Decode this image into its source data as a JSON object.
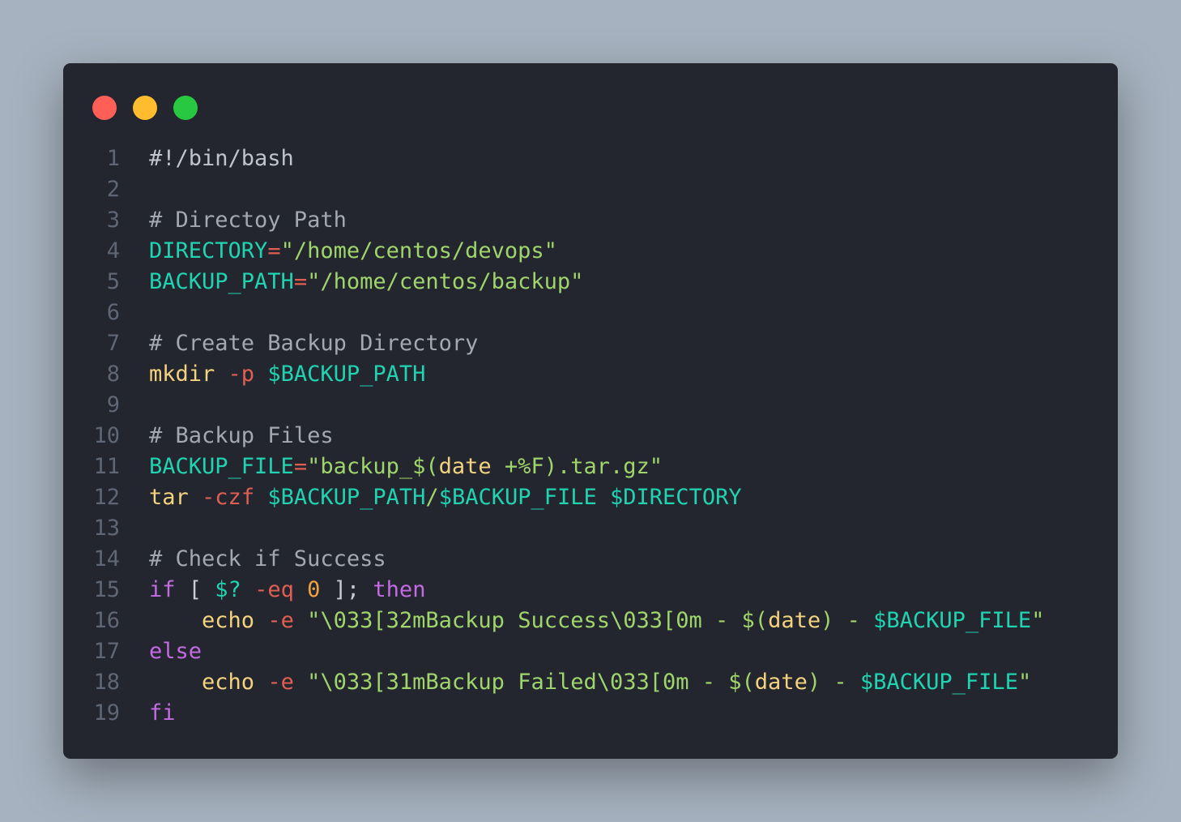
{
  "window": {
    "controls": [
      {
        "name": "close",
        "color": "#ff5f57"
      },
      {
        "name": "minimize",
        "color": "#febc2e"
      },
      {
        "name": "maximize",
        "color": "#28c840"
      }
    ]
  },
  "code": {
    "language": "bash",
    "lines": [
      {
        "n": "1",
        "tokens": [
          {
            "t": "#!/bin/bash",
            "c": "shebang"
          }
        ]
      },
      {
        "n": "2",
        "tokens": []
      },
      {
        "n": "3",
        "tokens": [
          {
            "t": "# Directoy Path",
            "c": "comment"
          }
        ]
      },
      {
        "n": "4",
        "tokens": [
          {
            "t": "DIRECTORY",
            "c": "var"
          },
          {
            "t": "=",
            "c": "op"
          },
          {
            "t": "\"/home/centos/devops\"",
            "c": "str"
          }
        ]
      },
      {
        "n": "5",
        "tokens": [
          {
            "t": "BACKUP_PATH",
            "c": "var"
          },
          {
            "t": "=",
            "c": "op"
          },
          {
            "t": "\"/home/centos/backup\"",
            "c": "str"
          }
        ]
      },
      {
        "n": "6",
        "tokens": []
      },
      {
        "n": "7",
        "tokens": [
          {
            "t": "# Create Backup Directory",
            "c": "comment"
          }
        ]
      },
      {
        "n": "8",
        "tokens": [
          {
            "t": "mkdir",
            "c": "cmd"
          },
          {
            "t": " ",
            "c": "plain"
          },
          {
            "t": "-p",
            "c": "flag"
          },
          {
            "t": " ",
            "c": "plain"
          },
          {
            "t": "$BACKUP_PATH",
            "c": "var"
          }
        ]
      },
      {
        "n": "9",
        "tokens": []
      },
      {
        "n": "10",
        "tokens": [
          {
            "t": "# Backup Files",
            "c": "comment"
          }
        ]
      },
      {
        "n": "11",
        "tokens": [
          {
            "t": "BACKUP_FILE",
            "c": "var"
          },
          {
            "t": "=",
            "c": "op"
          },
          {
            "t": "\"backup_$(",
            "c": "str"
          },
          {
            "t": "date",
            "c": "cmd"
          },
          {
            "t": " +%F).tar.gz\"",
            "c": "str"
          }
        ]
      },
      {
        "n": "12",
        "tokens": [
          {
            "t": "tar",
            "c": "cmd"
          },
          {
            "t": " ",
            "c": "plain"
          },
          {
            "t": "-czf",
            "c": "flag"
          },
          {
            "t": " ",
            "c": "plain"
          },
          {
            "t": "$BACKUP_PATH",
            "c": "var"
          },
          {
            "t": "/",
            "c": "str"
          },
          {
            "t": "$BACKUP_FILE",
            "c": "var"
          },
          {
            "t": " ",
            "c": "plain"
          },
          {
            "t": "$DIRECTORY",
            "c": "var"
          }
        ]
      },
      {
        "n": "13",
        "tokens": []
      },
      {
        "n": "14",
        "tokens": [
          {
            "t": "# Check if Success",
            "c": "comment"
          }
        ]
      },
      {
        "n": "15",
        "tokens": [
          {
            "t": "if",
            "c": "kw"
          },
          {
            "t": " [ ",
            "c": "plain"
          },
          {
            "t": "$?",
            "c": "var"
          },
          {
            "t": " ",
            "c": "plain"
          },
          {
            "t": "-eq",
            "c": "flag"
          },
          {
            "t": " ",
            "c": "plain"
          },
          {
            "t": "0",
            "c": "num"
          },
          {
            "t": " ]; ",
            "c": "plain"
          },
          {
            "t": "then",
            "c": "kw"
          }
        ]
      },
      {
        "n": "16",
        "tokens": [
          {
            "t": "    ",
            "c": "plain"
          },
          {
            "t": "echo",
            "c": "cmd"
          },
          {
            "t": " ",
            "c": "plain"
          },
          {
            "t": "-e",
            "c": "flag"
          },
          {
            "t": " ",
            "c": "plain"
          },
          {
            "t": "\"\\033[32mBackup Success\\033[0m - $(",
            "c": "str"
          },
          {
            "t": "date",
            "c": "cmd"
          },
          {
            "t": ") - ",
            "c": "str"
          },
          {
            "t": "$BACKUP_FILE",
            "c": "var"
          },
          {
            "t": "\"",
            "c": "str"
          }
        ]
      },
      {
        "n": "17",
        "tokens": [
          {
            "t": "else",
            "c": "kw"
          }
        ]
      },
      {
        "n": "18",
        "tokens": [
          {
            "t": "    ",
            "c": "plain"
          },
          {
            "t": "echo",
            "c": "cmd"
          },
          {
            "t": " ",
            "c": "plain"
          },
          {
            "t": "-e",
            "c": "flag"
          },
          {
            "t": " ",
            "c": "plain"
          },
          {
            "t": "\"\\033[31mBackup Failed\\033[0m - $(",
            "c": "str"
          },
          {
            "t": "date",
            "c": "cmd"
          },
          {
            "t": ") - ",
            "c": "str"
          },
          {
            "t": "$BACKUP_FILE",
            "c": "var"
          },
          {
            "t": "\"",
            "c": "str"
          }
        ]
      },
      {
        "n": "19",
        "tokens": [
          {
            "t": "fi",
            "c": "kw"
          }
        ]
      }
    ]
  }
}
